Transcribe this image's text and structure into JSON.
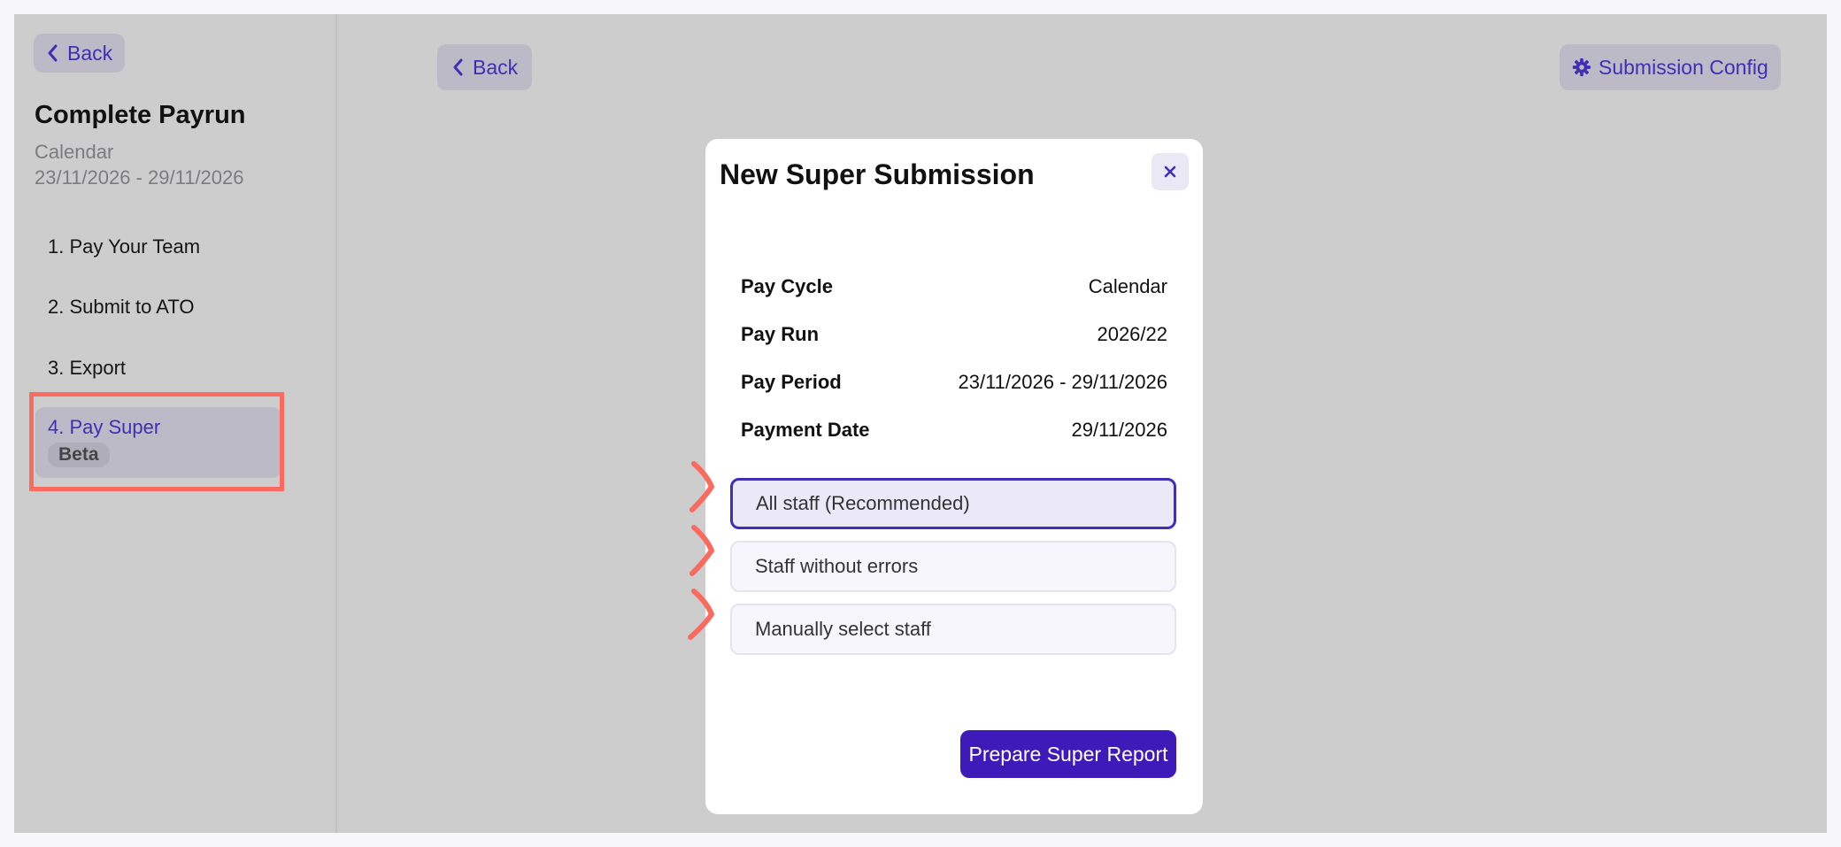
{
  "sidebar": {
    "back_label": "Back",
    "title": "Complete Payrun",
    "cycle": "Calendar",
    "period": "23/11/2026 - 29/11/2026",
    "steps": [
      {
        "label": "1. Pay Your Team"
      },
      {
        "label": "2. Submit to ATO"
      },
      {
        "label": "3. Export"
      },
      {
        "label": "4. Pay Super",
        "badge": "Beta"
      }
    ]
  },
  "header": {
    "back_label": "Back",
    "config_label": "Submission Config"
  },
  "modal": {
    "title": "New Super Submission",
    "rows": [
      {
        "key": "Pay Cycle",
        "value": "Calendar"
      },
      {
        "key": "Pay Run",
        "value": "2026/22"
      },
      {
        "key": "Pay Period",
        "value": "23/11/2026 - 29/11/2026"
      },
      {
        "key": "Payment Date",
        "value": "29/11/2026"
      }
    ],
    "options": [
      {
        "label": "All staff (Recommended)"
      },
      {
        "label": "Staff without errors"
      },
      {
        "label": "Manually select staff"
      }
    ],
    "primary_label": "Prepare Super Report"
  },
  "colors": {
    "accent": "#3e2fb5",
    "primary_button": "#3e1ab8",
    "annotation": "#fa6a5f"
  }
}
